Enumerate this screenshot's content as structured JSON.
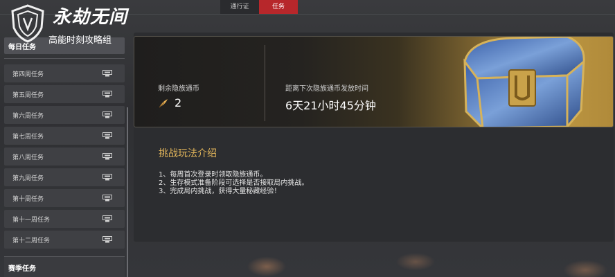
{
  "top_tabs": [
    {
      "label": "通行证",
      "active": false
    },
    {
      "label": "任务",
      "active": true
    }
  ],
  "logo": {
    "title": "永劫无间",
    "subtitle": "高能时刻攻略组"
  },
  "sidebar": {
    "daily_label": "每日任务",
    "items": [
      {
        "label": "第四周任务",
        "icon": "reward-icon"
      },
      {
        "label": "第五周任务",
        "icon": "reward-icon"
      },
      {
        "label": "第六周任务",
        "icon": "reward-icon"
      },
      {
        "label": "第七周任务",
        "icon": "reward-icon"
      },
      {
        "label": "第八周任务",
        "icon": "reward-icon"
      },
      {
        "label": "第九周任务",
        "icon": "reward-icon"
      },
      {
        "label": "第十周任务",
        "icon": "reward-icon"
      },
      {
        "label": "第十一周任务",
        "icon": "reward-icon"
      },
      {
        "label": "第十二周任务",
        "icon": "reward-icon"
      }
    ],
    "season_label": "赛季任务"
  },
  "banner": {
    "coin_label": "剩余隐族通币",
    "coin_value": "2",
    "time_label": "距离下次隐族通币发放时间",
    "time_value": "6天21小时45分钟"
  },
  "challenge": {
    "title": "挑战玩法介绍",
    "rules": [
      "1、每周首次登录时领取隐族通币。",
      "2、生存模式准备阶段可选择是否接取局内挑战。",
      "3、完成局内挑战，获得大量秘藏经验！"
    ]
  },
  "colors": {
    "accent_red": "#b7272b",
    "gold_title": "#e0b45a"
  }
}
